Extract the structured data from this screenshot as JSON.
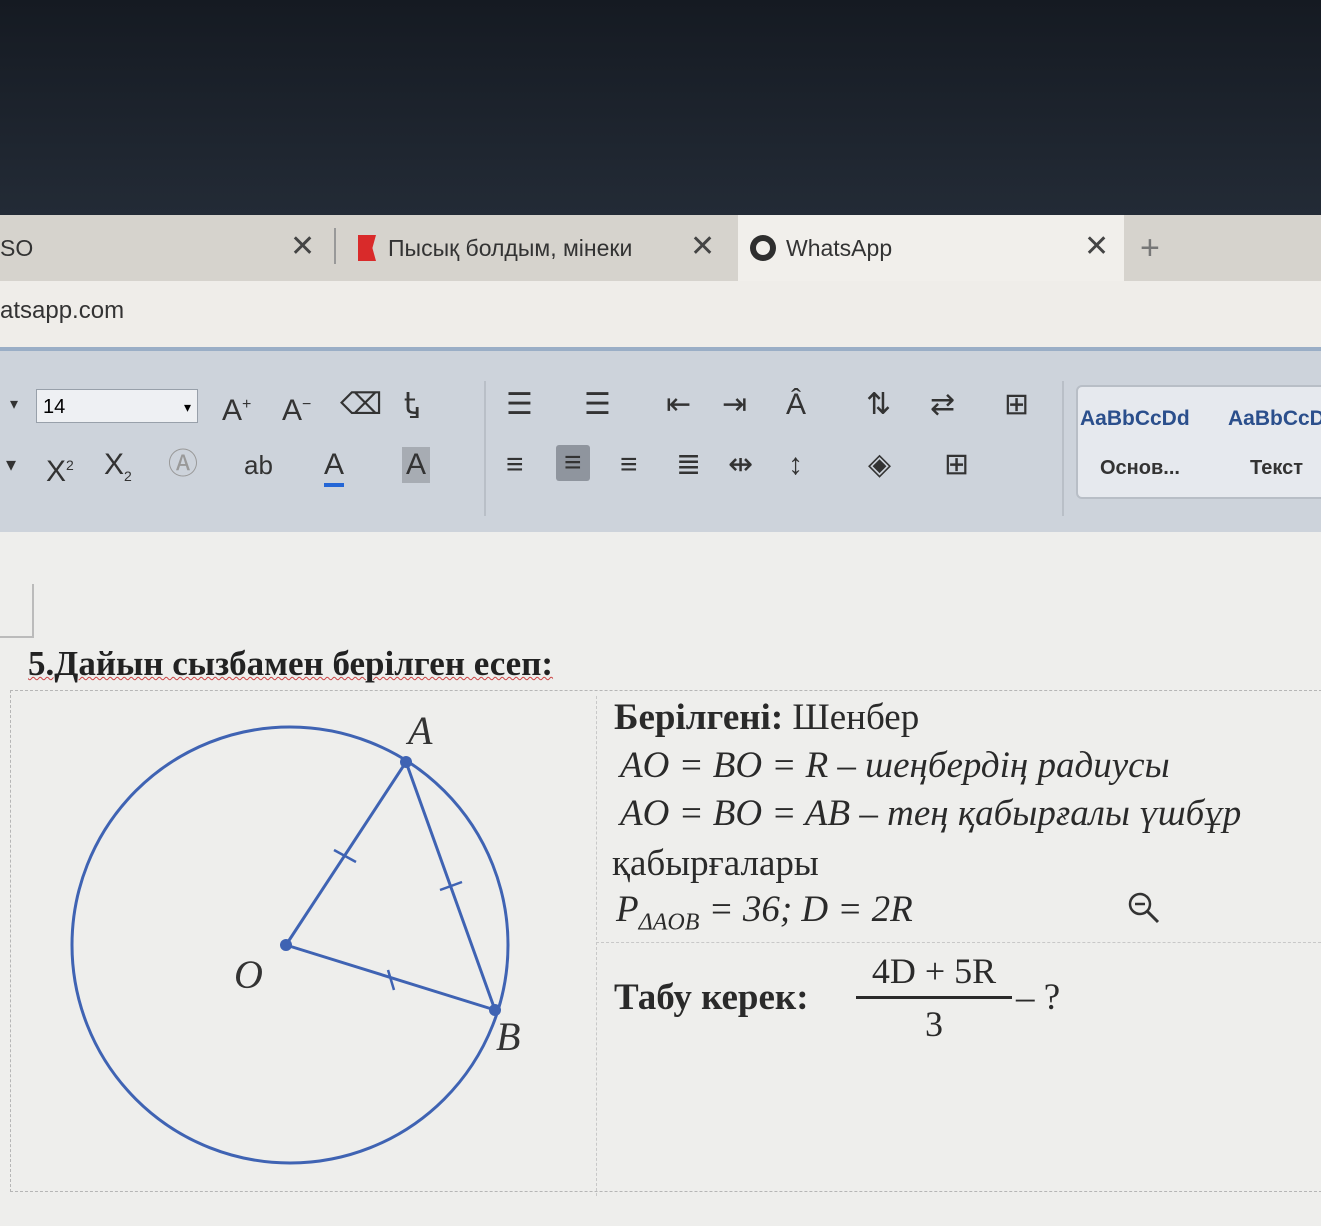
{
  "browser": {
    "tabs": [
      {
        "title": "SO",
        "close": "✕"
      },
      {
        "title": "Пысық болдым, мінеки",
        "close": "✕"
      },
      {
        "title": "WhatsApp",
        "close": "✕"
      }
    ],
    "new_tab": "+",
    "url": "atsapp.com"
  },
  "ribbon": {
    "font_size": "14",
    "grow_font": "A",
    "shrink_font": "A",
    "superscript": "X",
    "subscript": "X",
    "font_color": "A",
    "char_shading": "A",
    "styles": [
      {
        "preview": "AaBbCcDd",
        "name": "Основ..."
      },
      {
        "preview": "AaBbCcD",
        "name": "Текст"
      }
    ]
  },
  "problem": {
    "heading": "5.Дайын сызбамен берілген есеп:",
    "given_label": "Берілгені:",
    "given_value": "Шенбер",
    "line1": "AO = BO = R – шеңбердің радиусы",
    "line2": "AO = BO = AB – тең қабырғалы үшбұр",
    "line3": "қабырғалары",
    "perimeter_main": "P",
    "perimeter_sub": "ΔAOB",
    "perimeter_rest": "= 36; D = 2R",
    "find_label": "Табу керек:",
    "fraction_numerator": "4D + 5R",
    "fraction_denominator": "3",
    "find_suffix": "– ?"
  },
  "figure": {
    "labels": {
      "A": "A",
      "O": "O",
      "B": "B"
    },
    "line_color": "#3f63b3"
  }
}
